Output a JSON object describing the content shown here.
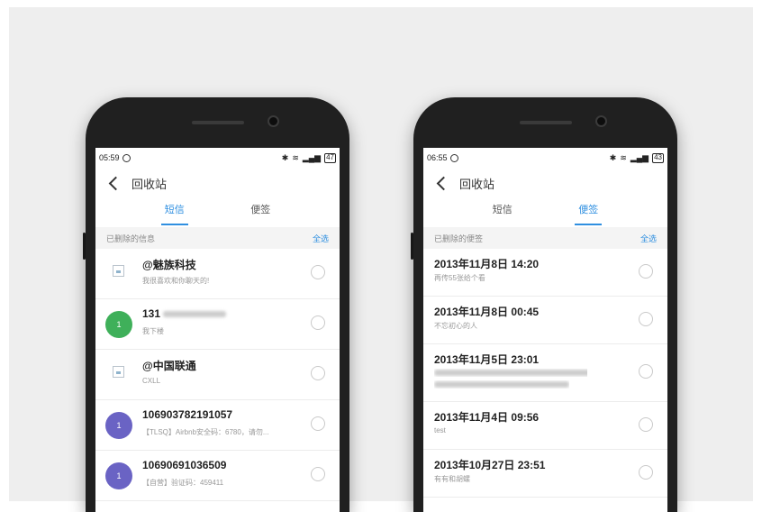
{
  "left_screen": {
    "status": {
      "time": "05:59",
      "battery": "47"
    },
    "title": "回收站",
    "tabs": [
      {
        "label": "短信",
        "active": true
      },
      {
        "label": "便签",
        "active": false
      }
    ],
    "section": {
      "label": "已删除的信息",
      "select_all": "全选"
    },
    "messages": [
      {
        "avatar": "",
        "avatar_type": "image-placeholder",
        "name": "@魅族科技",
        "preview": "我很喜欢和你聊天的!"
      },
      {
        "avatar": "1",
        "avatar_color": "#3fb05a",
        "name": "131",
        "name_blurred": true,
        "preview": "我下楼"
      },
      {
        "avatar": "",
        "avatar_type": "image-placeholder",
        "name": "@中国联通",
        "preview": "CXLL"
      },
      {
        "avatar": "1",
        "avatar_color": "#6a63c4",
        "name": "106903782191057",
        "preview": "【TLSQ】Airbnb安全码：6780，请勿..."
      },
      {
        "avatar": "1",
        "avatar_color": "#6a63c4",
        "name": "10690691036509",
        "preview": "【自营】验证码：459411"
      }
    ]
  },
  "right_screen": {
    "status": {
      "time": "06:55",
      "battery": "43"
    },
    "title": "回收站",
    "tabs": [
      {
        "label": "短信",
        "active": false
      },
      {
        "label": "便签",
        "active": true
      }
    ],
    "section": {
      "label": "已删除的便签",
      "select_all": "全选"
    },
    "notes": [
      {
        "title": "2013年11月8日 14:20",
        "preview": "再传55张给个看"
      },
      {
        "title": "2013年11月8日 00:45",
        "preview": "不忘初心的人"
      },
      {
        "title": "2013年11月5日 23:01",
        "preview": "",
        "preview_blurred": true
      },
      {
        "title": "2013年11月4日 09:56",
        "preview": "test"
      },
      {
        "title": "2013年10月27日 23:51",
        "preview": "有有和胡螺"
      }
    ]
  },
  "icons": [
    "clock-icon",
    "bluetooth-icon",
    "wifi-icon",
    "signal-icon",
    "battery-icon",
    "back-arrow-icon",
    "checkbox-circle-icon"
  ],
  "colors": {
    "accent": "#2f8fe0",
    "green_avatar": "#3fb05a",
    "purple_avatar": "#6a63c4"
  }
}
